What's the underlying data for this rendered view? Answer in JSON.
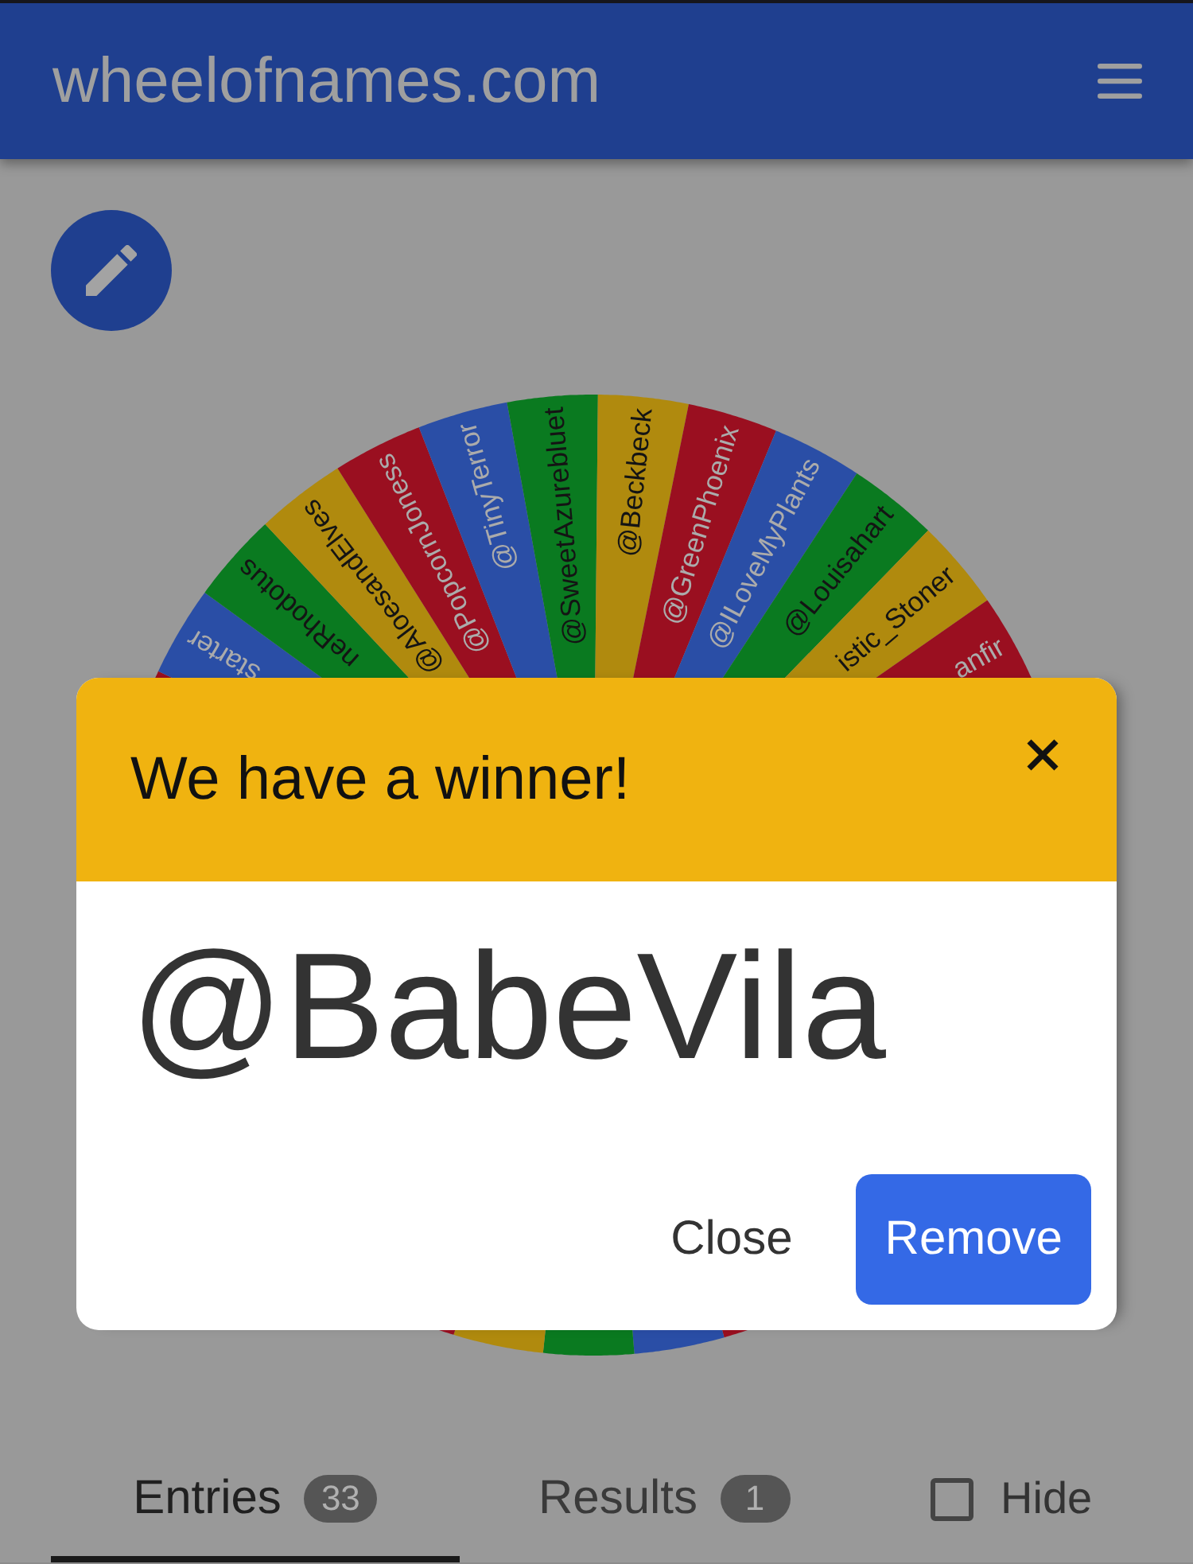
{
  "header": {
    "title": "wheelofnames.com"
  },
  "wheel": {
    "top_segments": [
      {
        "color": "#9a0f20"
      },
      {
        "label": "starter",
        "color": "#2a4ea6"
      },
      {
        "label": "neRhodotus",
        "color": "#0a7a20"
      },
      {
        "label": "@AloesandElves",
        "color": "#b08a0e"
      },
      {
        "label": "@PopcornJoness",
        "color": "#9a0f20"
      },
      {
        "label": "@TinyTerror",
        "color": "#2a4ea6"
      },
      {
        "label": "@SweetAzurebluet",
        "color": "#0a7a20"
      },
      {
        "label": "@Beckbeck",
        "color": "#b08a0e"
      },
      {
        "label": "@GreenPhoenix",
        "color": "#9a0f20"
      },
      {
        "label": "@ILoveMyPlants",
        "color": "#2a4ea6"
      },
      {
        "label": "@Louisahart",
        "color": "#0a7a20"
      },
      {
        "label": "istic_Stoner",
        "color": "#b08a0e"
      },
      {
        "label": "anfir",
        "color": "#9a0f20"
      }
    ],
    "bottom_segments": [
      {
        "color": "#9a0f20"
      },
      {
        "color": "#2a4ea6"
      },
      {
        "color": "#0a7a20"
      },
      {
        "color": "#b08a0e"
      },
      {
        "color": "#9a0f20"
      }
    ]
  },
  "tabs": [
    {
      "label": "Entries",
      "count": "33",
      "selected": true
    },
    {
      "label": "Results",
      "count": "1",
      "selected": false
    }
  ],
  "hide_option": {
    "label": "Hide",
    "checked": false
  },
  "winner_dialog": {
    "title": "We have a winner!",
    "winner": "@BabeVila",
    "buttons": [
      {
        "label": "Close",
        "kind": "text"
      },
      {
        "label": "Remove",
        "kind": "primary"
      }
    ]
  }
}
